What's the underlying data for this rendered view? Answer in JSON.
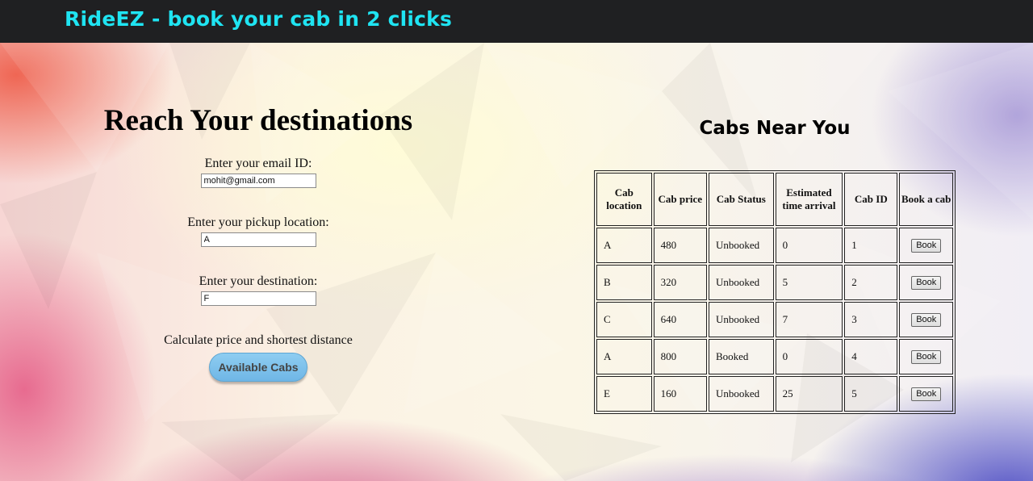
{
  "brand": "RideEZ - book your cab in 2 clicks",
  "form": {
    "heading": "Reach Your destinations",
    "email_label": "Enter your email ID:",
    "email_value": "mohit@gmail.com",
    "pickup_label": "Enter your pickup location:",
    "pickup_value": "A",
    "destination_label": "Enter your destination:",
    "destination_value": "F",
    "calc_label": "Calculate price and shortest distance",
    "button_label": "Available Cabs"
  },
  "cabs": {
    "heading": "Cabs Near You",
    "columns": [
      "Cab location",
      "Cab price",
      "Cab Status",
      "Estimated time arrival",
      "Cab ID",
      "Book a cab"
    ],
    "book_label": "Book",
    "rows": [
      {
        "location": "A",
        "price": "480",
        "status": "Unbooked",
        "eta": "0",
        "id": "1"
      },
      {
        "location": "B",
        "price": "320",
        "status": "Unbooked",
        "eta": "5",
        "id": "2"
      },
      {
        "location": "C",
        "price": "640",
        "status": "Unbooked",
        "eta": "7",
        "id": "3"
      },
      {
        "location": "A",
        "price": "800",
        "status": "Booked",
        "eta": "0",
        "id": "4"
      },
      {
        "location": "E",
        "price": "160",
        "status": "Unbooked",
        "eta": "25",
        "id": "5"
      }
    ]
  },
  "colors": {
    "brand_text": "#1fe4f2",
    "topbar_bg": "#1f2022",
    "button_bg": "#7fc2ec"
  }
}
